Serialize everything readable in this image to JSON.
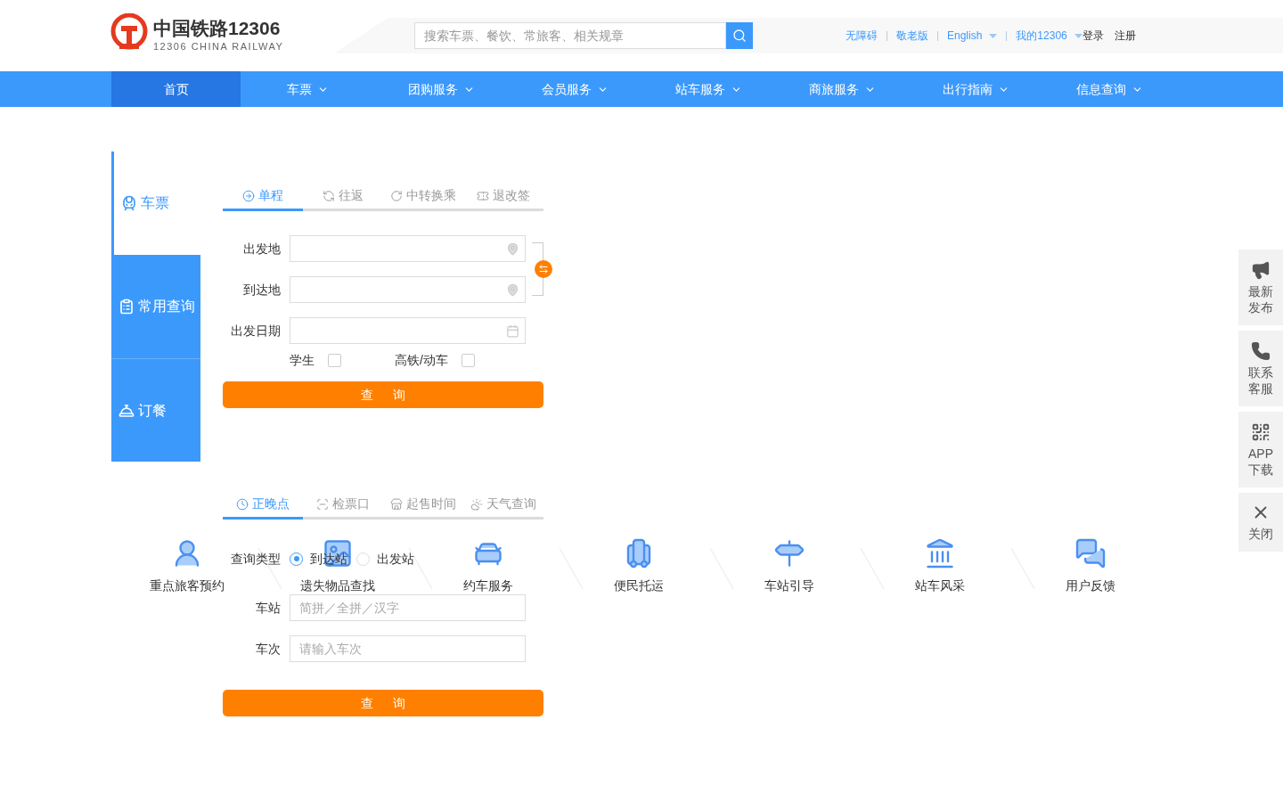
{
  "header": {
    "logo": {
      "title": "中国铁路12306",
      "subtitle": "12306 CHINA RAILWAY"
    },
    "search": {
      "placeholder": "搜索车票、餐饮、常旅客、相关规章"
    },
    "links": [
      {
        "label": "无障碍",
        "kind": "link",
        "dropdown": false
      },
      {
        "label": "敬老版",
        "kind": "link",
        "dropdown": false
      },
      {
        "label": "English",
        "kind": "link",
        "dropdown": true
      },
      {
        "label": "我的12306",
        "kind": "link",
        "dropdown": true
      },
      {
        "label": "登录",
        "kind": "account",
        "dropdown": false
      },
      {
        "label": "注册",
        "kind": "account",
        "dropdown": false
      }
    ]
  },
  "nav": [
    {
      "label": "首页",
      "selected": true,
      "dropdown": false
    },
    {
      "label": "车票",
      "selected": false,
      "dropdown": true
    },
    {
      "label": "团购服务",
      "selected": false,
      "dropdown": true
    },
    {
      "label": "会员服务",
      "selected": false,
      "dropdown": true
    },
    {
      "label": "站车服务",
      "selected": false,
      "dropdown": true
    },
    {
      "label": "商旅服务",
      "selected": false,
      "dropdown": true
    },
    {
      "label": "出行指南",
      "selected": false,
      "dropdown": true
    },
    {
      "label": "信息查询",
      "selected": false,
      "dropdown": true
    }
  ],
  "side_tabs": [
    {
      "label": "车票",
      "selected": true
    },
    {
      "label": "常用查询",
      "selected": false
    },
    {
      "label": "订餐",
      "selected": false
    }
  ],
  "ticket_form": {
    "tabs": [
      {
        "label": "单程",
        "selected": true
      },
      {
        "label": "往返",
        "selected": false
      },
      {
        "label": "中转换乘",
        "selected": false
      },
      {
        "label": "退改签",
        "selected": false
      }
    ],
    "fields": [
      {
        "label": "出发地",
        "kind": "place"
      },
      {
        "label": "到达地",
        "kind": "place"
      },
      {
        "label": "出发日期",
        "kind": "date"
      }
    ],
    "options": [
      {
        "label": "学生",
        "checked": false
      },
      {
        "label": "高铁/动车",
        "checked": false
      }
    ],
    "button": "查 询"
  },
  "query_form": {
    "tabs": [
      {
        "label": "正晚点",
        "selected": true
      },
      {
        "label": "检票口",
        "selected": false
      },
      {
        "label": "起售时间",
        "selected": false
      },
      {
        "label": "天气查询",
        "selected": false
      }
    ],
    "query_type": {
      "label": "查询类型",
      "options": [
        {
          "label": "到达站",
          "selected": true
        },
        {
          "label": "出发站",
          "selected": false
        }
      ]
    },
    "fields": [
      {
        "label": "车站",
        "placeholder": "简拼／全拼／汉字"
      },
      {
        "label": "车次",
        "placeholder": "请输入车次"
      }
    ],
    "button": "查 询"
  },
  "services": [
    {
      "label": "重点旅客预约"
    },
    {
      "label": "遗失物品查找"
    },
    {
      "label": "约车服务"
    },
    {
      "label": "便民托运"
    },
    {
      "label": "车站引导"
    },
    {
      "label": "站车风采"
    },
    {
      "label": "用户反馈"
    }
  ],
  "float_bar": [
    {
      "label": "最新发布"
    },
    {
      "label": "联系客服"
    },
    {
      "label": "APP下载"
    },
    {
      "label": "关闭"
    }
  ]
}
